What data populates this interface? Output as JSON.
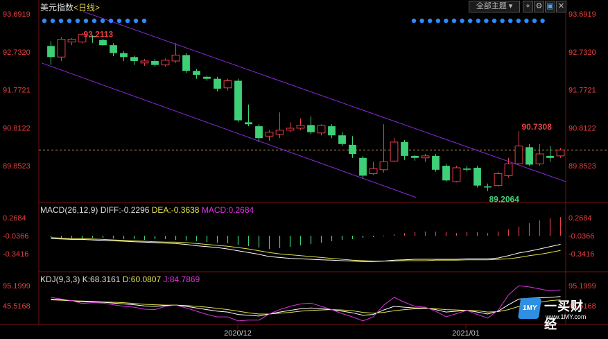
{
  "header": {
    "title": "美元指数",
    "period": "<日线>",
    "theme_selector": "全部主题"
  },
  "panels": {
    "macd_label": "MACD(26,12,9)",
    "macd_diff": "DIFF:-0.2296",
    "macd_dea": "DEA:-0.3638",
    "macd_macd": "MACD:0.2684",
    "kdj_label": "KDJ(9,3,3)",
    "kdj_k": "K:68.3161",
    "kdj_d": "D:60.0807",
    "kdj_j": "J:84.7869"
  },
  "colors": {
    "up": "#e8404a",
    "down": "#3ed077",
    "channel": "#8a2be2",
    "dea": "#e5e34a",
    "diff": "#ffffff",
    "j": "#e030e0",
    "axis_text": "#e84040",
    "dot": "#2a8cff"
  },
  "watermark": {
    "brand": "一买财经",
    "site": "www.1MY.com",
    "logo_text": "1MY"
  },
  "chart_data": {
    "type": "candlestick",
    "price_axis": {
      "ticks": [
        "93.6919",
        "92.7320",
        "91.7721",
        "90.8122",
        "89.8523"
      ],
      "values": [
        93.6919,
        92.732,
        91.7721,
        90.8122,
        89.8523
      ]
    },
    "macd_axis": {
      "ticks": [
        "0.2684",
        "-0.0366",
        "-0.3416"
      ]
    },
    "kdj_axis": {
      "ticks": [
        "95.1999",
        "45.5168"
      ]
    },
    "x_labels": [
      "2020/12",
      "2021/01"
    ],
    "annotations": {
      "high_label": "93.2113",
      "low_label": "89.2064",
      "recent_high_label": "90.7308"
    },
    "candles": [
      [
        92.88,
        92.6,
        93.0,
        92.4
      ],
      [
        92.6,
        93.05,
        93.1,
        92.5
      ],
      [
        92.98,
        93.05,
        93.08,
        92.9
      ],
      [
        92.98,
        93.17,
        93.21,
        92.95
      ],
      [
        93.13,
        93.1,
        93.15,
        92.96
      ],
      [
        93.03,
        92.9,
        93.06,
        92.88
      ],
      [
        92.9,
        92.7,
        92.95,
        92.62
      ],
      [
        92.7,
        92.6,
        92.75,
        92.5
      ],
      [
        92.6,
        92.5,
        92.64,
        92.4
      ],
      [
        92.45,
        92.5,
        92.55,
        92.38
      ],
      [
        92.5,
        92.4,
        92.55,
        92.35
      ],
      [
        92.4,
        92.52,
        92.56,
        92.36
      ],
      [
        92.5,
        92.65,
        92.95,
        92.45
      ],
      [
        92.65,
        92.25,
        92.7,
        92.2
      ],
      [
        92.25,
        92.15,
        92.3,
        92.05
      ],
      [
        92.1,
        92.05,
        92.13,
        92.0
      ],
      [
        92.05,
        91.8,
        92.1,
        91.73
      ],
      [
        91.82,
        92.0,
        92.05,
        91.75
      ],
      [
        92.0,
        91.0,
        92.05,
        90.95
      ],
      [
        90.95,
        90.9,
        91.4,
        90.85
      ],
      [
        90.85,
        90.55,
        90.9,
        90.45
      ],
      [
        90.6,
        90.7,
        90.75,
        90.48
      ],
      [
        90.65,
        90.75,
        91.2,
        90.55
      ],
      [
        90.75,
        90.8,
        90.95,
        90.7
      ],
      [
        90.8,
        90.87,
        91.05,
        90.75
      ],
      [
        90.88,
        90.7,
        91.1,
        90.65
      ],
      [
        90.68,
        90.87,
        90.9,
        90.62
      ],
      [
        90.85,
        90.62,
        90.9,
        90.55
      ],
      [
        90.62,
        90.4,
        90.7,
        90.35
      ],
      [
        90.38,
        90.15,
        90.6,
        90.05
      ],
      [
        90.05,
        89.6,
        90.1,
        89.55
      ],
      [
        89.65,
        89.78,
        89.95,
        89.62
      ],
      [
        89.75,
        89.95,
        90.9,
        89.68
      ],
      [
        89.97,
        90.45,
        90.55,
        89.95
      ],
      [
        90.45,
        90.1,
        90.5,
        90.0
      ],
      [
        90.1,
        90.05,
        90.12,
        89.98
      ],
      [
        90.05,
        90.1,
        90.15,
        89.95
      ],
      [
        90.1,
        89.75,
        90.15,
        89.7
      ],
      [
        89.85,
        89.48,
        89.9,
        89.45
      ],
      [
        89.45,
        89.8,
        89.85,
        89.43
      ],
      [
        89.78,
        89.75,
        89.85,
        89.7
      ],
      [
        89.8,
        89.35,
        89.85,
        89.3
      ],
      [
        89.33,
        89.3,
        89.4,
        89.21
      ],
      [
        89.35,
        89.65,
        89.7,
        89.32
      ],
      [
        89.6,
        89.9,
        90.05,
        89.55
      ],
      [
        89.9,
        90.35,
        90.73,
        89.88
      ],
      [
        90.32,
        89.88,
        90.4,
        89.85
      ],
      [
        89.9,
        90.15,
        90.4,
        89.85
      ],
      [
        90.1,
        90.05,
        90.35,
        89.95
      ],
      [
        90.1,
        90.25,
        90.3,
        90.05
      ]
    ],
    "macd_hist": [
      -0.02,
      -0.03,
      -0.04,
      -0.04,
      -0.03,
      -0.03,
      -0.04,
      -0.05,
      -0.05,
      -0.06,
      -0.05,
      -0.05,
      -0.06,
      -0.07,
      -0.08,
      -0.09,
      -0.1,
      -0.11,
      -0.13,
      -0.15,
      -0.17,
      -0.19,
      -0.18,
      -0.16,
      -0.14,
      -0.12,
      -0.1,
      -0.08,
      -0.06,
      -0.05,
      -0.03,
      -0.02,
      -0.01,
      0.02,
      0.04,
      0.05,
      0.06,
      0.06,
      0.05,
      0.04,
      0.05,
      0.05,
      0.04,
      0.06,
      0.09,
      0.13,
      0.18,
      0.22,
      0.25,
      0.2684
    ],
    "macd_diff": [
      -0.1,
      -0.11,
      -0.12,
      -0.12,
      -0.13,
      -0.14,
      -0.15,
      -0.16,
      -0.17,
      -0.18,
      -0.19,
      -0.2,
      -0.21,
      -0.23,
      -0.26,
      -0.28,
      -0.3,
      -0.33,
      -0.37,
      -0.41,
      -0.45,
      -0.5,
      -0.52,
      -0.54,
      -0.55,
      -0.56,
      -0.57,
      -0.58,
      -0.59,
      -0.6,
      -0.61,
      -0.61,
      -0.6,
      -0.58,
      -0.57,
      -0.56,
      -0.56,
      -0.56,
      -0.56,
      -0.56,
      -0.55,
      -0.55,
      -0.55,
      -0.53,
      -0.48,
      -0.42,
      -0.38,
      -0.33,
      -0.28,
      -0.2296
    ],
    "macd_dea": [
      -0.08,
      -0.09,
      -0.1,
      -0.1,
      -0.11,
      -0.12,
      -0.13,
      -0.14,
      -0.15,
      -0.16,
      -0.17,
      -0.18,
      -0.18,
      -0.19,
      -0.21,
      -0.23,
      -0.25,
      -0.27,
      -0.3,
      -0.33,
      -0.37,
      -0.41,
      -0.44,
      -0.46,
      -0.48,
      -0.5,
      -0.52,
      -0.54,
      -0.56,
      -0.58,
      -0.59,
      -0.6,
      -0.6,
      -0.6,
      -0.59,
      -0.59,
      -0.59,
      -0.58,
      -0.58,
      -0.58,
      -0.57,
      -0.57,
      -0.57,
      -0.56,
      -0.55,
      -0.52,
      -0.48,
      -0.45,
      -0.41,
      -0.3638
    ],
    "kdj_k": [
      62,
      60,
      58,
      55,
      55,
      54,
      52,
      50,
      48,
      45,
      44,
      46,
      47,
      44,
      40,
      36,
      32,
      30,
      24,
      22,
      20,
      25,
      30,
      34,
      38,
      40,
      38,
      36,
      32,
      28,
      22,
      24,
      35,
      44,
      42,
      40,
      40,
      36,
      30,
      32,
      34,
      30,
      25,
      32,
      48,
      62,
      64,
      65,
      66,
      68.3161
    ],
    "kdj_d": [
      60,
      59,
      58,
      57,
      56,
      55,
      54,
      53,
      51,
      49,
      48,
      47,
      47,
      46,
      44,
      42,
      39,
      36,
      32,
      28,
      25,
      25,
      27,
      29,
      32,
      34,
      35,
      36,
      35,
      33,
      29,
      27,
      29,
      33,
      36,
      38,
      39,
      38,
      36,
      35,
      34,
      33,
      30,
      31,
      36,
      44,
      50,
      54,
      58,
      60.0807
    ],
    "kdj_j": [
      66,
      62,
      58,
      51,
      53,
      52,
      48,
      44,
      42,
      37,
      36,
      44,
      47,
      40,
      32,
      24,
      18,
      18,
      8,
      10,
      10,
      25,
      36,
      44,
      50,
      52,
      44,
      36,
      26,
      18,
      8,
      18,
      47,
      66,
      54,
      44,
      42,
      32,
      18,
      26,
      34,
      24,
      15,
      34,
      72,
      95,
      92,
      87,
      82,
      84.7869
    ]
  }
}
